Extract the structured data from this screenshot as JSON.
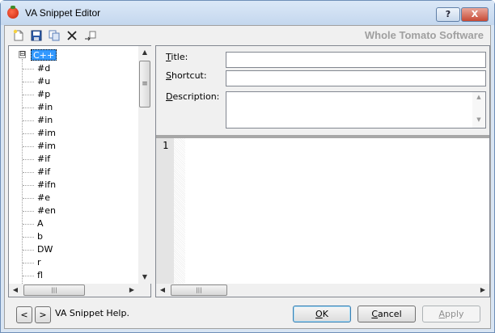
{
  "window": {
    "title": "VA Snippet Editor",
    "help_button": "?",
    "close_button": "X"
  },
  "toolbar": {
    "tools": [
      {
        "name": "new-snippet",
        "icon": "new-document-icon"
      },
      {
        "name": "save",
        "icon": "floppy-disk-icon"
      },
      {
        "name": "copy",
        "icon": "copy-icon"
      },
      {
        "name": "delete",
        "icon": "x-delete-icon"
      },
      {
        "name": "import",
        "icon": "import-icon"
      }
    ],
    "brand": "Whole Tomato Software"
  },
  "tree": {
    "root": "C++",
    "expander": "⊟",
    "items": [
      "#d",
      "#u",
      "#p",
      "#in",
      "#in",
      "#im",
      "#im",
      "#if",
      "#if",
      "#ifn",
      "#e",
      "#en",
      "A",
      "b",
      "DW",
      "r",
      "fl",
      "..."
    ]
  },
  "form": {
    "title_label": {
      "mnemonic": "T",
      "rest": "itle:"
    },
    "shortcut_label": {
      "mnemonic": "S",
      "rest": "hortcut:"
    },
    "description_label": {
      "mnemonic": "D",
      "rest": "escription:"
    },
    "title_value": "",
    "shortcut_value": "",
    "description_value": ""
  },
  "editor": {
    "line_numbers": [
      "1"
    ]
  },
  "footer": {
    "prev_button": "<",
    "next_button": ">",
    "help_text": "VA Snippet Help.",
    "ok_button": {
      "mnemonic": "O",
      "rest": "K"
    },
    "cancel_button": {
      "mnemonic": "C",
      "rest": "ancel"
    },
    "apply_button": {
      "mnemonic": "A",
      "rest": "pply"
    }
  },
  "scroll_glyphs": {
    "up": "▲",
    "down": "▼",
    "left": "◀",
    "right": "▶",
    "grip_h": "|||",
    "grip_v": "≡"
  }
}
